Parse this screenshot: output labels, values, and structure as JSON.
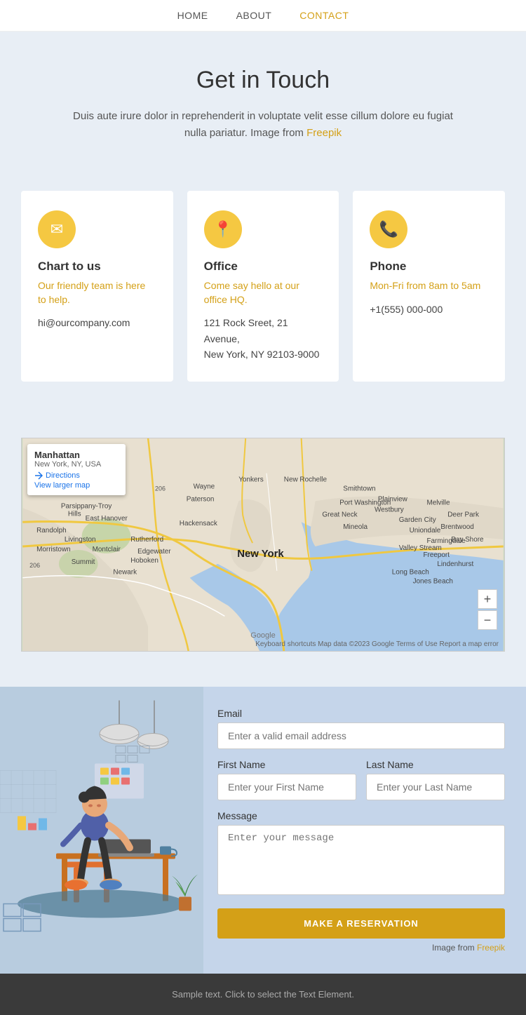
{
  "nav": {
    "items": [
      {
        "label": "HOME",
        "href": "#",
        "active": false
      },
      {
        "label": "ABOUT",
        "href": "#",
        "active": false
      },
      {
        "label": "CONTACT",
        "href": "#",
        "active": true
      }
    ]
  },
  "hero": {
    "title": "Get in Touch",
    "description": "Duis aute irure dolor in reprehenderit in voluptate velit esse cillum dolore eu fugiat nulla pariatur. Image from",
    "link_text": "Freepik",
    "link_href": "#"
  },
  "cards": [
    {
      "icon": "✉",
      "title": "Chart to us",
      "subtitle": "Our friendly team is here to help.",
      "detail": "hi@ourcompany.com"
    },
    {
      "icon": "📍",
      "title": "Office",
      "subtitle": "Come say hello at our office HQ.",
      "detail": "121 Rock Sreet, 21 Avenue,\nNew York, NY 92103-9000"
    },
    {
      "icon": "📞",
      "title": "Phone",
      "subtitle": "Mon-Fri from 8am to 5am",
      "detail": "+1(555) 000-000"
    }
  ],
  "map": {
    "popup": {
      "name": "Manhattan",
      "sub": "New York, NY, USA",
      "directions": "Directions",
      "view_larger": "View larger map"
    },
    "footer": "Keyboard shortcuts  Map data ©2023 Google  Terms of Use  Report a map error",
    "zoom_in": "+",
    "zoom_out": "−"
  },
  "form": {
    "email_label": "Email",
    "email_placeholder": "Enter a valid email address",
    "first_name_label": "First Name",
    "first_name_placeholder": "Enter your First Name",
    "last_name_label": "Last Name",
    "last_name_placeholder": "Enter your Last Name",
    "message_label": "Message",
    "message_placeholder": "Enter your message",
    "submit_label": "MAKE A RESERVATION",
    "image_credit_text": "Image from",
    "image_credit_link": "Freepik"
  },
  "footer": {
    "text": "Sample text. Click to select the Text Element."
  }
}
